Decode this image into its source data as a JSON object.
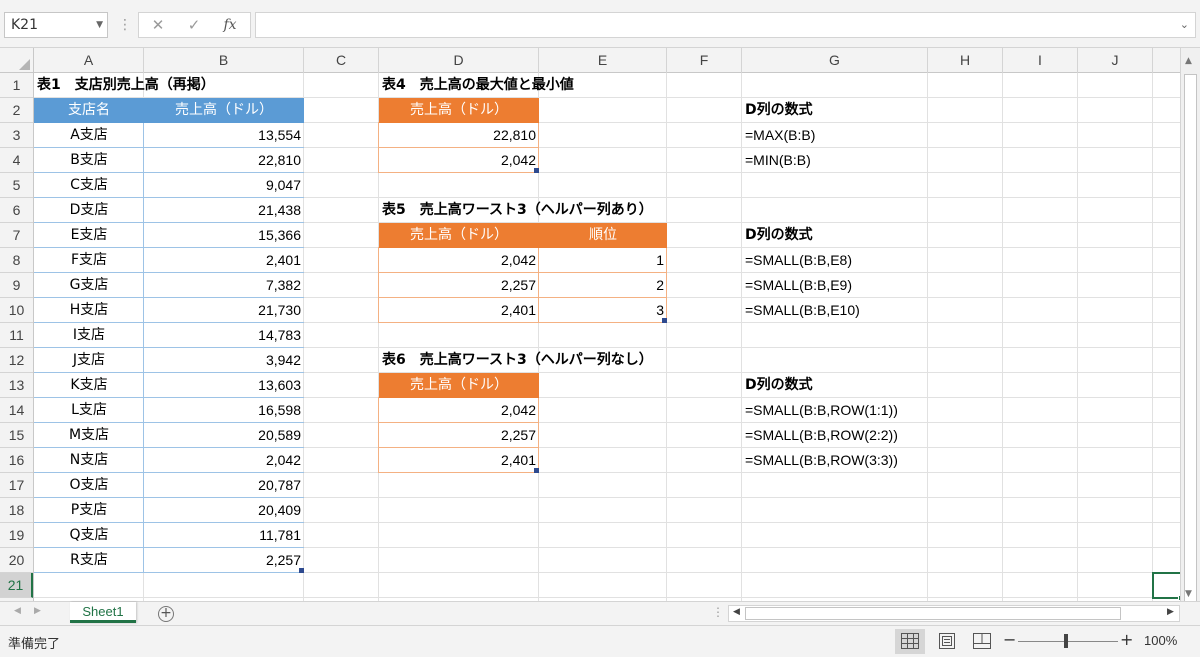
{
  "formula_bar": {
    "name_box": "K21",
    "cancel_glyph": "✕",
    "enter_glyph": "✓",
    "fx_label": "fx",
    "formula": ""
  },
  "columns": [
    "A",
    "B",
    "C",
    "D",
    "E",
    "F",
    "G",
    "H",
    "I",
    "J"
  ],
  "rows": [
    "1",
    "2",
    "3",
    "4",
    "5",
    "6",
    "7",
    "8",
    "9",
    "10",
    "11",
    "12",
    "13",
    "14",
    "15",
    "16",
    "17",
    "18",
    "19",
    "20",
    "21"
  ],
  "table1": {
    "title": "表1　支店別売上高（再掲）",
    "header_branch": "支店名",
    "header_sales": "売上高（ドル）",
    "rows": [
      {
        "branch": "A支店",
        "sales": "13,554"
      },
      {
        "branch": "B支店",
        "sales": "22,810"
      },
      {
        "branch": "C支店",
        "sales": "9,047"
      },
      {
        "branch": "D支店",
        "sales": "21,438"
      },
      {
        "branch": "E支店",
        "sales": "15,366"
      },
      {
        "branch": "F支店",
        "sales": "2,401"
      },
      {
        "branch": "G支店",
        "sales": "7,382"
      },
      {
        "branch": "H支店",
        "sales": "21,730"
      },
      {
        "branch": "I支店",
        "sales": "14,783"
      },
      {
        "branch": "J支店",
        "sales": "3,942"
      },
      {
        "branch": "K支店",
        "sales": "13,603"
      },
      {
        "branch": "L支店",
        "sales": "16,598"
      },
      {
        "branch": "M支店",
        "sales": "20,589"
      },
      {
        "branch": "N支店",
        "sales": "2,042"
      },
      {
        "branch": "O支店",
        "sales": "20,787"
      },
      {
        "branch": "P支店",
        "sales": "20,409"
      },
      {
        "branch": "Q支店",
        "sales": "11,781"
      },
      {
        "branch": "R支店",
        "sales": "2,257"
      }
    ]
  },
  "table4": {
    "title": "表4　売上高の最大値と最小値",
    "header_sales": "売上高（ドル）",
    "values": [
      "22,810",
      "2,042"
    ],
    "formula_heading": "D列の数式",
    "formulas": [
      "=MAX(B:B)",
      "=MIN(B:B)"
    ]
  },
  "table5": {
    "title": "表5　売上高ワースト3（ヘルパー列あり）",
    "header_sales": "売上高（ドル）",
    "header_rank": "順位",
    "rows": [
      {
        "sales": "2,042",
        "rank": "1"
      },
      {
        "sales": "2,257",
        "rank": "2"
      },
      {
        "sales": "2,401",
        "rank": "3"
      }
    ],
    "formula_heading": "D列の数式",
    "formulas": [
      "=SMALL(B:B,E8)",
      "=SMALL(B:B,E9)",
      "=SMALL(B:B,E10)"
    ]
  },
  "table6": {
    "title": "表6　売上高ワースト3（ヘルパー列なし）",
    "header_sales": "売上高（ドル）",
    "values": [
      "2,042",
      "2,257",
      "2,401"
    ],
    "formula_heading": "D列の数式",
    "formulas": [
      "=SMALL(B:B,ROW(1:1))",
      "=SMALL(B:B,ROW(2:2))",
      "=SMALL(B:B,ROW(3:3))"
    ]
  },
  "sheet_tab": "Sheet1",
  "add_sheet_glyph": "+",
  "status": {
    "text": "準備完了",
    "zoom_minus": "−",
    "zoom_plus": "+",
    "zoom": "100%"
  },
  "colors": {
    "blue_header": "#5b9bd5",
    "orange_header": "#ed7d31",
    "selection": "#217346"
  }
}
